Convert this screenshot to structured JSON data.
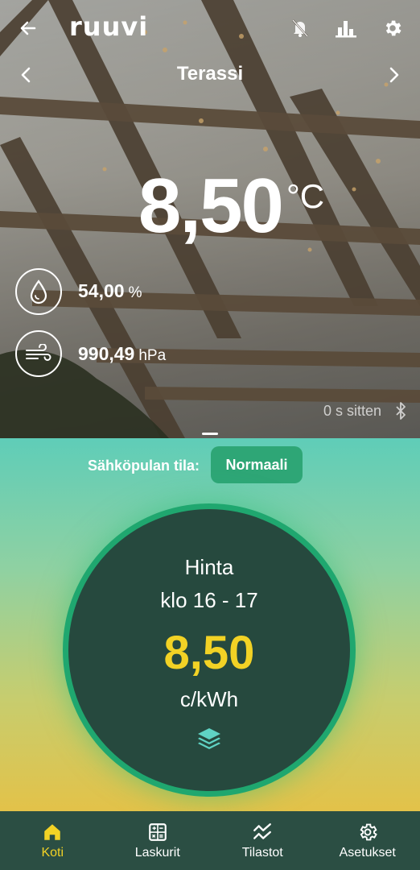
{
  "header": {
    "logo": "ruuvi",
    "sensor_name": "Terassi",
    "icons": [
      "back-arrow-icon",
      "bell-off-icon",
      "bar-chart-icon",
      "gear-icon",
      "chevron-left-icon",
      "chevron-right-icon"
    ]
  },
  "measurements": {
    "temperature": "8,50",
    "temperature_unit": "°C",
    "humidity": "54,00",
    "humidity_unit": "%",
    "pressure": "990,49",
    "pressure_unit": "hPa",
    "updated": "0 s sitten"
  },
  "panel": {
    "status_label": "Sähköpulan tila:",
    "status_value": "Normaali",
    "price_title": "Hinta",
    "price_time": "klo 16 - 17",
    "price_value": "8,50",
    "price_unit": "c/kWh"
  },
  "nav": {
    "items": [
      {
        "label": "Koti",
        "icon": "home-icon"
      },
      {
        "label": "Laskurit",
        "icon": "calculator-icon"
      },
      {
        "label": "Tilastot",
        "icon": "trend-icon"
      },
      {
        "label": "Asetukset",
        "icon": "gear-icon"
      }
    ]
  },
  "colors": {
    "accent": "#f2d225",
    "status_chip": "#2ea676",
    "price_circle": "#26493e",
    "nav_bg": "#2b4e43"
  }
}
